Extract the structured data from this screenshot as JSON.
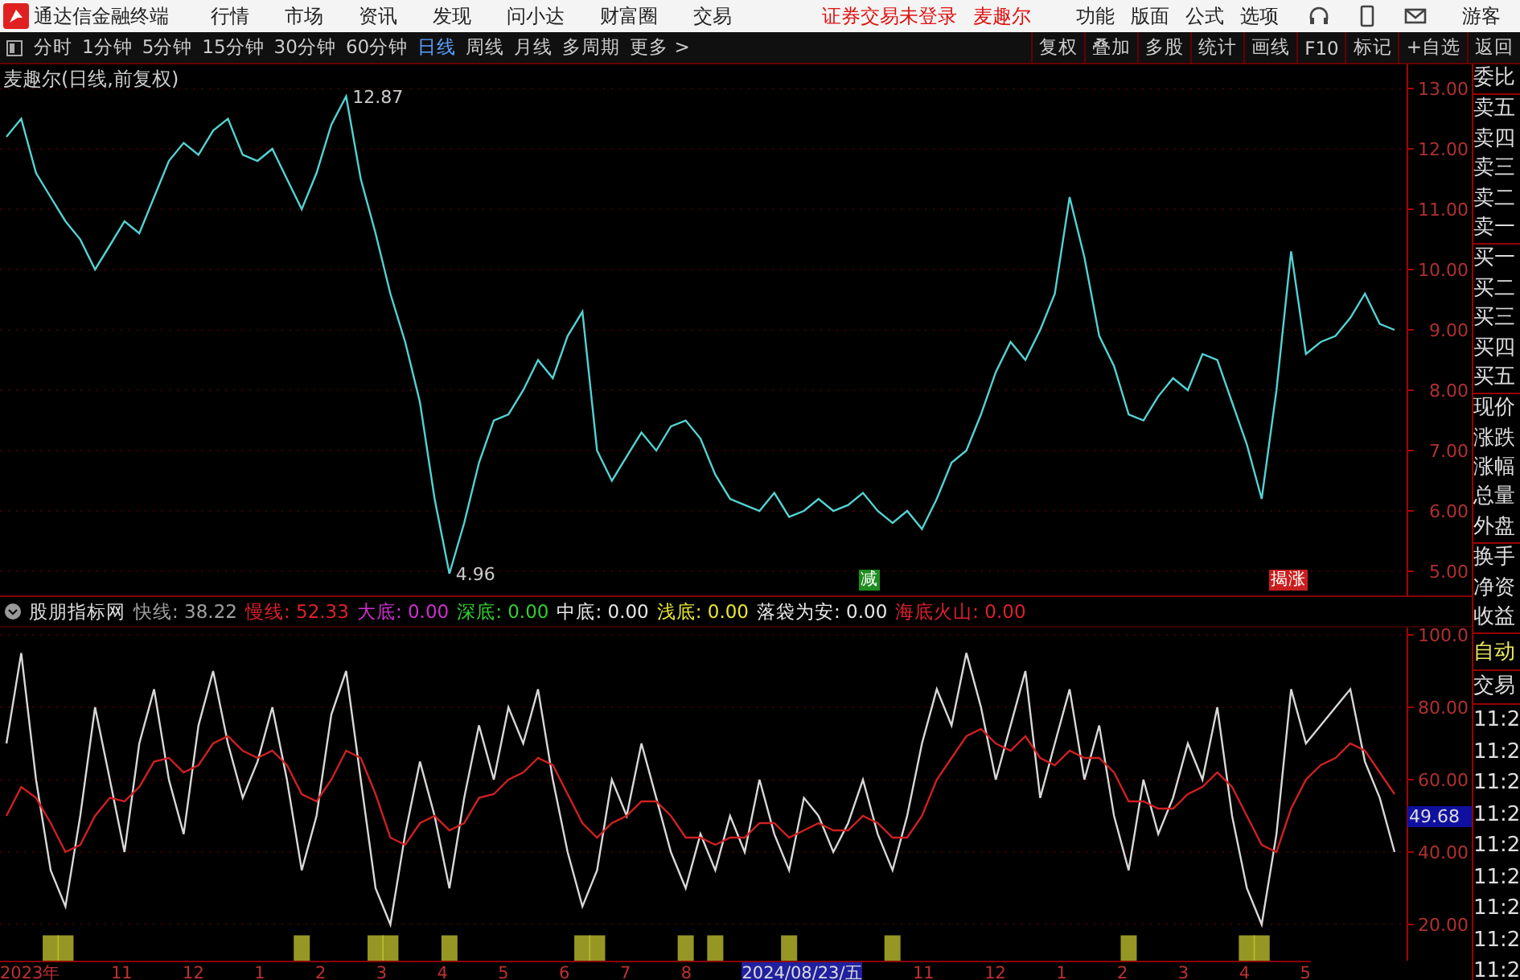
{
  "menu_bar": {
    "app_title": "通达信金融终端",
    "menus": [
      "行情",
      "市场",
      "资讯",
      "发现",
      "问小达",
      "财富圈",
      "交易"
    ],
    "status": "证券交易未登录",
    "stock": "麦趣尔",
    "tools": [
      "功能",
      "版面",
      "公式",
      "选项"
    ],
    "user": "游客"
  },
  "period_bar": {
    "periods": [
      {
        "label": "分时",
        "selected": false
      },
      {
        "label": "1分钟",
        "selected": false
      },
      {
        "label": "5分钟",
        "selected": false
      },
      {
        "label": "15分钟",
        "selected": false
      },
      {
        "label": "30分钟",
        "selected": false
      },
      {
        "label": "60分钟",
        "selected": false
      },
      {
        "label": "日线",
        "selected": true
      },
      {
        "label": "周线",
        "selected": false
      },
      {
        "label": "月线",
        "selected": false
      },
      {
        "label": "多周期",
        "selected": false
      },
      {
        "label": "更多 >",
        "selected": false
      }
    ],
    "actions": [
      "复权",
      "叠加",
      "多股",
      "统计",
      "画线",
      "F10",
      "标记",
      "+自选",
      "返回"
    ]
  },
  "price_chart": {
    "title": "麦趣尔(日线,前复权)",
    "signal_tags": [
      {
        "text": "减",
        "color": "#1e8c1e"
      },
      {
        "text": "揭涨",
        "color": "#c81e1e"
      }
    ],
    "chart_data": {
      "type": "line",
      "ylim": [
        4.6,
        13.4
      ],
      "grid": true,
      "yticks": [
        {
          "value": 13,
          "label": "13.00"
        },
        {
          "value": 12,
          "label": "12.00"
        },
        {
          "value": 11,
          "label": "11.00"
        },
        {
          "value": 10,
          "label": "10.00"
        },
        {
          "value": 9,
          "label": "9.00"
        },
        {
          "value": 8,
          "label": "8.00"
        },
        {
          "value": 7,
          "label": "7.00"
        },
        {
          "value": 6,
          "label": "6.00"
        },
        {
          "value": 5,
          "label": "5.00"
        }
      ],
      "series": [
        {
          "color": "#54d2d2",
          "values": [
            12.2,
            12.5,
            11.6,
            11.2,
            10.8,
            10.5,
            10.0,
            10.4,
            10.8,
            10.6,
            11.2,
            11.8,
            12.1,
            11.9,
            12.3,
            12.5,
            11.9,
            11.8,
            12.0,
            11.5,
            11.0,
            11.6,
            12.4,
            12.87,
            11.5,
            10.6,
            9.6,
            8.8,
            7.8,
            6.2,
            4.96,
            5.8,
            6.8,
            7.5,
            7.6,
            8.0,
            8.5,
            8.2,
            8.9,
            9.3,
            7.0,
            6.5,
            6.9,
            7.3,
            7.0,
            7.4,
            7.5,
            7.2,
            6.6,
            6.2,
            6.1,
            6.0,
            6.3,
            5.9,
            6.0,
            6.2,
            6.0,
            6.1,
            6.3,
            6.0,
            5.8,
            6.0,
            5.7,
            6.2,
            6.8,
            7.0,
            7.6,
            8.3,
            8.8,
            8.5,
            9.0,
            9.6,
            11.2,
            10.2,
            8.9,
            8.4,
            7.6,
            7.5,
            7.9,
            8.2,
            8.0,
            8.6,
            8.5,
            7.8,
            7.1,
            6.2,
            8.0,
            10.3,
            8.6,
            8.8,
            8.9,
            9.2,
            9.6,
            9.1,
            9.0
          ]
        }
      ],
      "annotations": [
        "12.87",
        "4.96"
      ]
    }
  },
  "indicator": {
    "name": "股朋指标网",
    "legend_separator": ":",
    "legend": [
      {
        "value": "38.22",
        "color": "#a0a0a0"
      },
      {
        "value": "52.33",
        "color": "#e0202a"
      },
      {
        "label": "大底",
        "value": "0.00",
        "color": "#d030d0"
      },
      {
        "label": "深底",
        "value": "0.00",
        "color": "#30d030"
      },
      {
        "label": "中底",
        "value": "0.00",
        "color": "#e8e8e8"
      },
      {
        "label": "浅底",
        "value": "0.00",
        "color": "#e8e830"
      },
      {
        "label": "落袋为安",
        "value": "0.00",
        "color": "#e8e8e8"
      },
      {
        "label": "海底火山",
        "value": "0.00",
        "color": "#e0202a"
      }
    ],
    "current_value": "49.68",
    "chart_data": {
      "type": "line",
      "ylim": [
        10,
        102
      ],
      "grid": true,
      "yticks": [
        {
          "value": 100,
          "label": "100.0"
        },
        {
          "value": 80,
          "label": "80.00"
        },
        {
          "value": 60,
          "label": "60.00"
        },
        {
          "value": 40,
          "label": "40.00"
        },
        {
          "value": 20,
          "label": "20.00"
        }
      ],
      "series": [
        {
          "name": "快线",
          "color": "#d8d8d8",
          "values": [
            70,
            95,
            60,
            35,
            25,
            50,
            80,
            60,
            40,
            70,
            85,
            60,
            45,
            75,
            90,
            70,
            55,
            65,
            80,
            60,
            35,
            50,
            78,
            90,
            60,
            30,
            20,
            45,
            65,
            50,
            30,
            55,
            75,
            60,
            80,
            70,
            85,
            60,
            40,
            25,
            35,
            60,
            50,
            70,
            55,
            40,
            30,
            45,
            35,
            50,
            40,
            60,
            45,
            35,
            55,
            50,
            40,
            48,
            60,
            45,
            35,
            50,
            70,
            85,
            75,
            95,
            80,
            60,
            75,
            90,
            55,
            70,
            85,
            60,
            75,
            50,
            35,
            60,
            45,
            55,
            70,
            60,
            80,
            50,
            30,
            20,
            45,
            85,
            70,
            75,
            80,
            85,
            65,
            55,
            40
          ]
        },
        {
          "name": "慢线",
          "color": "#d02020",
          "values": [
            50,
            58,
            55,
            48,
            40,
            42,
            50,
            55,
            54,
            58,
            65,
            66,
            62,
            64,
            70,
            72,
            68,
            66,
            68,
            64,
            56,
            54,
            60,
            68,
            66,
            56,
            44,
            42,
            48,
            50,
            46,
            48,
            55,
            56,
            60,
            62,
            66,
            64,
            56,
            48,
            44,
            48,
            50,
            54,
            54,
            50,
            44,
            44,
            42,
            44,
            44,
            48,
            48,
            44,
            46,
            48,
            46,
            46,
            50,
            48,
            44,
            44,
            50,
            60,
            66,
            72,
            74,
            70,
            68,
            72,
            66,
            64,
            68,
            66,
            66,
            62,
            54,
            54,
            52,
            52,
            56,
            58,
            62,
            58,
            50,
            42,
            40,
            52,
            60,
            64,
            66,
            70,
            68,
            62,
            56
          ]
        }
      ]
    }
  },
  "time_axis": [
    {
      "label": "2023年",
      "selected": false
    },
    {
      "label": "11",
      "selected": false
    },
    {
      "label": "12",
      "selected": false
    },
    {
      "label": "1",
      "selected": false
    },
    {
      "label": "2",
      "selected": false
    },
    {
      "label": "3",
      "selected": false
    },
    {
      "label": "4",
      "selected": false
    },
    {
      "label": "5",
      "selected": false
    },
    {
      "label": "6",
      "selected": false
    },
    {
      "label": "7",
      "selected": false
    },
    {
      "label": "8",
      "selected": false
    },
    {
      "label": "2024/08/23/五",
      "selected": true
    },
    {
      "label": "11",
      "selected": false
    },
    {
      "label": "12",
      "selected": false
    },
    {
      "label": "1",
      "selected": false
    },
    {
      "label": "2",
      "selected": false
    },
    {
      "label": "3",
      "selected": false
    },
    {
      "label": "4",
      "selected": false
    },
    {
      "label": "5",
      "selected": false
    }
  ],
  "quote_panel": {
    "groups": [
      [
        "委比"
      ],
      [
        "卖五",
        "卖四",
        "卖三",
        "卖二",
        "卖一"
      ],
      [
        "买一",
        "买二",
        "买三",
        "买四",
        "买五"
      ],
      [
        "现价",
        "涨跌",
        "涨幅",
        "总量",
        "外盘"
      ],
      [
        "换手",
        "净资",
        "收益"
      ]
    ]
  },
  "trade_panel": {
    "auto": "自动",
    "header": "交易",
    "times": [
      "11:2",
      "11:2",
      "11:2",
      "11:2",
      "11:2",
      "11:2",
      "11:2",
      "11:2",
      "11:2"
    ]
  }
}
